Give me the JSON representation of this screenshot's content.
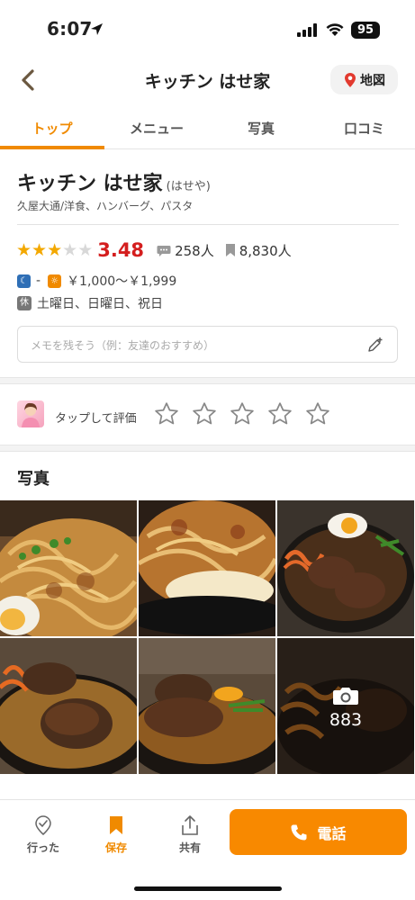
{
  "status": {
    "time": "6:07",
    "battery": "95"
  },
  "nav": {
    "title": "キッチン はせ家",
    "map_label": "地図"
  },
  "tabs": [
    {
      "label": "トップ",
      "active": true
    },
    {
      "label": "メニュー"
    },
    {
      "label": "写真"
    },
    {
      "label": "口コミ"
    }
  ],
  "shop": {
    "name": "キッチン はせ家",
    "kana": "(はせや)",
    "area": "久屋大通/洋食、ハンバーグ、パスタ",
    "rating": {
      "stars": 3,
      "score": "3.48",
      "reviews": "258人",
      "saves": "8,830人"
    },
    "dinner_price": "-",
    "lunch_price": "￥1,000～￥1,999",
    "closed_badge": "休",
    "closed_days": "土曜日、日曜日、祝日",
    "memo_placeholder": "メモを残そう（例：友達のおすすめ）"
  },
  "rate": {
    "label": "タップして評価"
  },
  "photos": {
    "heading": "写真",
    "count": "883"
  },
  "bottom": {
    "went": "行った",
    "saved": "保存",
    "share": "共有",
    "call": "電話"
  },
  "colors": {
    "accent": "#f08a00",
    "score_red": "#d41e1e"
  }
}
